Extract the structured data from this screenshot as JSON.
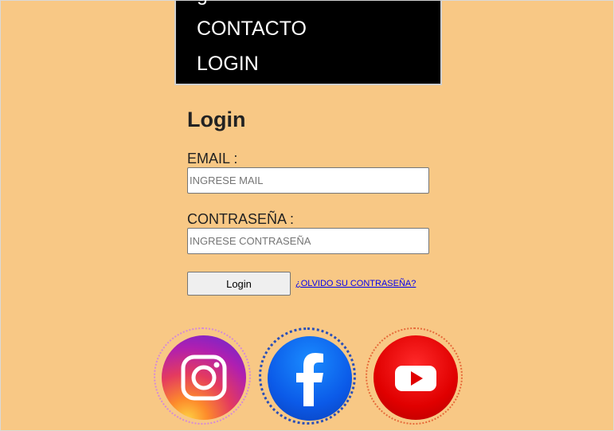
{
  "nav": {
    "items": [
      {
        "label": "CONTACTO"
      },
      {
        "label": "LOGIN"
      }
    ]
  },
  "login": {
    "title": "Login",
    "email_label": "EMAIL :",
    "email_placeholder": "INGRESE MAIL",
    "email_value": "",
    "password_label": "CONTRASEÑA :",
    "password_placeholder": "INGRESE CONTRASEÑA",
    "password_value": "",
    "submit_label": "Login",
    "forgot_link": "¿OLVIDO SU CONTRASEÑA?"
  },
  "social": [
    {
      "icon": "instagram-icon",
      "color": "#c13584"
    },
    {
      "icon": "facebook-icon",
      "color": "#1877f2"
    },
    {
      "icon": "youtube-icon",
      "color": "#ff0000"
    }
  ],
  "colors": {
    "background": "#f8c885",
    "menu_background": "#000000",
    "link": "#0000ee"
  }
}
